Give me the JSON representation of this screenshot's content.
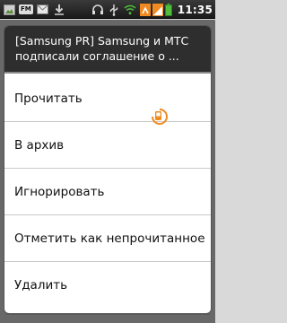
{
  "status_bar": {
    "fm_label": "FM",
    "time": "11:35",
    "icons": [
      "photo-icon",
      "fm-radio-icon",
      "message-icon",
      "download-icon",
      "headphones-icon",
      "usb-icon",
      "wifi-icon",
      "sync-icon",
      "signal-icon",
      "battery-icon"
    ]
  },
  "dialog": {
    "title_line1": "[Samsung PR] Samsung и МТС",
    "title_line2": "подписали соглашение о ...",
    "items": [
      {
        "label": "Прочитать"
      },
      {
        "label": "В архив"
      },
      {
        "label": "Игнорировать"
      },
      {
        "label": "Отметить как непрочитанное"
      },
      {
        "label": "Удалить"
      }
    ]
  },
  "colors": {
    "accent": "#f08a22",
    "title_bg": "#2e2e2e",
    "dialog_bg": "#ffffff"
  }
}
